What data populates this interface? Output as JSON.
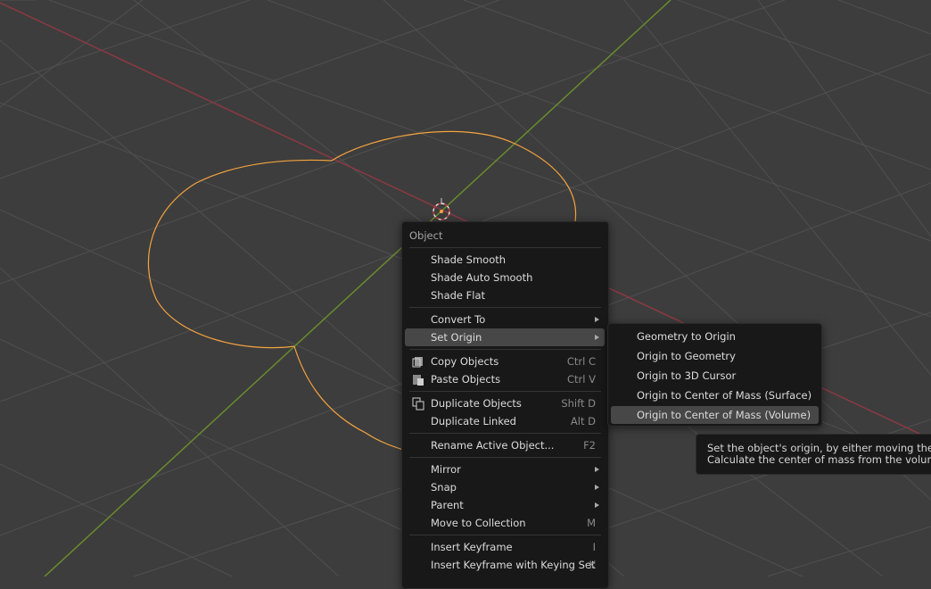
{
  "viewport": {
    "background": "#3d3d3d",
    "x_axis_color": "#8c3943",
    "y_axis_color": "#6a8c2e",
    "selection_color": "#f5a33e"
  },
  "object_menu": {
    "title": "Object",
    "items": [
      {
        "label": "Shade Smooth",
        "shortcut": ""
      },
      {
        "label": "Shade Auto Smooth",
        "shortcut": ""
      },
      {
        "label": "Shade Flat",
        "shortcut": ""
      },
      {
        "label": "Convert To",
        "shortcut": ""
      },
      {
        "label": "Set Origin",
        "shortcut": ""
      },
      {
        "label": "Copy Objects",
        "shortcut": "Ctrl C"
      },
      {
        "label": "Paste Objects",
        "shortcut": "Ctrl V"
      },
      {
        "label": "Duplicate Objects",
        "shortcut": "Shift D"
      },
      {
        "label": "Duplicate Linked",
        "shortcut": "Alt D"
      },
      {
        "label": "Rename Active Object...",
        "shortcut": "F2"
      },
      {
        "label": "Mirror",
        "shortcut": ""
      },
      {
        "label": "Snap",
        "shortcut": ""
      },
      {
        "label": "Parent",
        "shortcut": ""
      },
      {
        "label": "Move to Collection",
        "shortcut": "M"
      },
      {
        "label": "Insert Keyframe",
        "shortcut": "I"
      },
      {
        "label": "Insert Keyframe with Keying Set",
        "shortcut": "K"
      }
    ]
  },
  "set_origin_submenu": {
    "items": [
      {
        "label": "Geometry to Origin"
      },
      {
        "label": "Origin to Geometry"
      },
      {
        "label": "Origin to 3D Cursor"
      },
      {
        "label": "Origin to Center of Mass (Surface)"
      },
      {
        "label": "Origin to Center of Mass (Volume)"
      }
    ],
    "highlighted": "Origin to Center of Mass (Volume)"
  },
  "tooltip": {
    "line1": "Set the object's origin, by either moving the dat",
    "line2": "Calculate the center of mass from the volume (m"
  }
}
